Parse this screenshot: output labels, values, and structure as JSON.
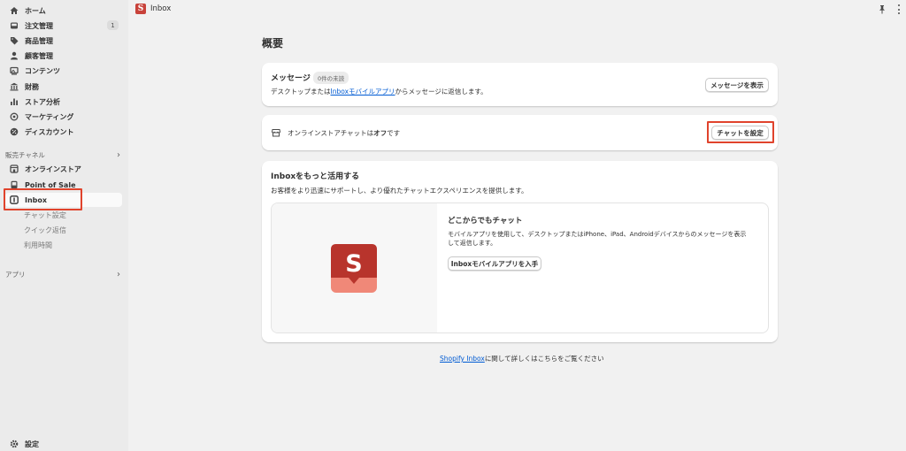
{
  "sidebar": {
    "items": [
      {
        "label": "ホーム",
        "icon": "home-icon"
      },
      {
        "label": "注文管理",
        "icon": "inbox-tray-icon",
        "badge": "1"
      },
      {
        "label": "商品管理",
        "icon": "tag-icon"
      },
      {
        "label": "顧客管理",
        "icon": "person-icon"
      },
      {
        "label": "コンテンツ",
        "icon": "image-icon"
      },
      {
        "label": "財務",
        "icon": "bank-icon"
      },
      {
        "label": "ストア分析",
        "icon": "bar-chart-icon"
      },
      {
        "label": "マーケティング",
        "icon": "target-icon"
      },
      {
        "label": "ディスカウント",
        "icon": "discount-icon"
      }
    ],
    "sales_channels_label": "販売チャネル",
    "channels": [
      {
        "label": "オンラインストア",
        "icon": "storefront-icon"
      },
      {
        "label": "Point of Sale",
        "icon": "pos-icon"
      },
      {
        "label": "Inbox",
        "icon": "inbox-app-icon"
      }
    ],
    "inbox_subitems": [
      "チャット設定",
      "クイック返信",
      "利用時間"
    ],
    "apps_label": "アプリ",
    "settings_label": "設定"
  },
  "topbar": {
    "app_logo_letter": "S",
    "app_name": "Inbox"
  },
  "main": {
    "page_title": "概要",
    "messages_card": {
      "title": "メッセージ",
      "unread_pill": "0件の未読",
      "text_before": "デスクトップまたは",
      "link_text": "Inboxモバイルアプリ",
      "text_after": "からメッセージに返信します。",
      "button": "メッセージを表示"
    },
    "chat_card": {
      "text_before": "オンラインストアチャットは",
      "status": "オフ",
      "text_after": "です",
      "button": "チャットを設定"
    },
    "promo_card": {
      "title": "Inboxをもっと活用する",
      "subtitle": "お客様をより迅速にサポートし、より優れたチャットエクスペリエンスを提供します。",
      "feature_title": "どこからでもチャット",
      "feature_text_line1": "モバイルアプリを使用して、デスクトップまたはiPhone、iPad、Androidデバイスからのメッセージを表示",
      "feature_text_line2": "して返信します。",
      "button": "Inboxモバイルアプリを入手"
    },
    "footer": {
      "link_text": "Shopify Inbox",
      "text_after": "に関して詳しくはこちらをご覧ください"
    }
  },
  "colors": {
    "highlight_outline": "#e0432c",
    "logo_red": "#c8423a",
    "link_blue": "#005bd3"
  }
}
